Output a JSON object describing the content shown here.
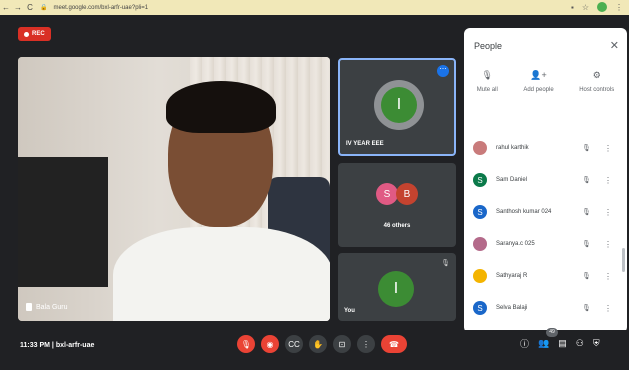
{
  "browser": {
    "url": "meet.google.com/bxl-arfr-uae?pli=1",
    "back": "←",
    "forward": "→",
    "reload": "C"
  },
  "meeting": {
    "rec_label": "REC",
    "time": "11:33 PM",
    "separator": "|",
    "code": "bxl-arfr-uae"
  },
  "main_tile": {
    "name": "Bala Guru"
  },
  "tiles": [
    {
      "label": "IV YEAR EEE",
      "avatar_letter": "I"
    },
    {
      "label": "46 others",
      "avatar_letters": [
        "S",
        "B"
      ]
    },
    {
      "label": "You",
      "avatar_letter": "I"
    }
  ],
  "panel": {
    "title": "People",
    "actions": [
      {
        "label": "Mute all",
        "icon": "mute-all-icon"
      },
      {
        "label": "Add people",
        "icon": "add-person-icon"
      },
      {
        "label": "Host controls",
        "icon": "host-controls-icon"
      }
    ],
    "participants": [
      {
        "name": "rahul karthik",
        "avatar": "photo",
        "color": "#c97b7b"
      },
      {
        "name": "Sam Daniel",
        "avatar": "S",
        "color": "#0b7a4a"
      },
      {
        "name": "Santhosh kumar 024",
        "avatar": "S",
        "color": "#1a67c9"
      },
      {
        "name": "Saranya.c 025",
        "avatar": "photo",
        "color": "#b46a8a"
      },
      {
        "name": "Sathyaraj R",
        "avatar": "photo",
        "color": "#f4b400"
      },
      {
        "name": "Selva Balaji",
        "avatar": "S",
        "color": "#1a67c9"
      }
    ]
  },
  "controls": {
    "participant_count": "49"
  }
}
